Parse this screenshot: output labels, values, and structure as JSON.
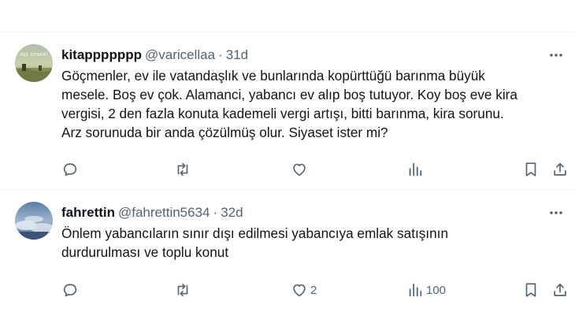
{
  "tweets": [
    {
      "name": "kitappppppp",
      "handle": "@varicellaa",
      "separator": "·",
      "time": "31d",
      "text": "Göçmenler, ev ile vatandaşlık ve bunlarında kopürttüğü barınma büyük\nmesele. Boş ev çok. Alamanci, yabancı ev alıp boş tutuyor. Koy boş eve kira\nvergisi, 2 den fazla konuta kademeli vergi artışı, bitti barınma, kira sorunu.\nArz sorunuda bir anda çözülmüş olur. Siyaset ister mi?",
      "avatar_lettering": "AŞK DENENİ",
      "counts": {
        "reply": "",
        "retweet": "",
        "like": "",
        "views": ""
      }
    },
    {
      "name": "fahrettin",
      "handle": "@fahrettin5634",
      "separator": "·",
      "time": "32d",
      "text": "Önlem yabancıların sınır dışı edilmesi yabancıya emlak satışının\ndurdurulması ve toplu konut",
      "counts": {
        "reply": "",
        "retweet": "",
        "like": "2",
        "views": "100"
      }
    }
  ],
  "icons": {
    "more": "more-horizontal-icon",
    "reply": "reply-icon",
    "retweet": "retweet-icon",
    "like": "heart-icon",
    "views": "views-icon",
    "bookmark": "bookmark-icon",
    "share": "share-icon"
  },
  "colors": {
    "text_primary": "#0f1419",
    "text_secondary": "#536471",
    "divider": "#eff3f4"
  }
}
